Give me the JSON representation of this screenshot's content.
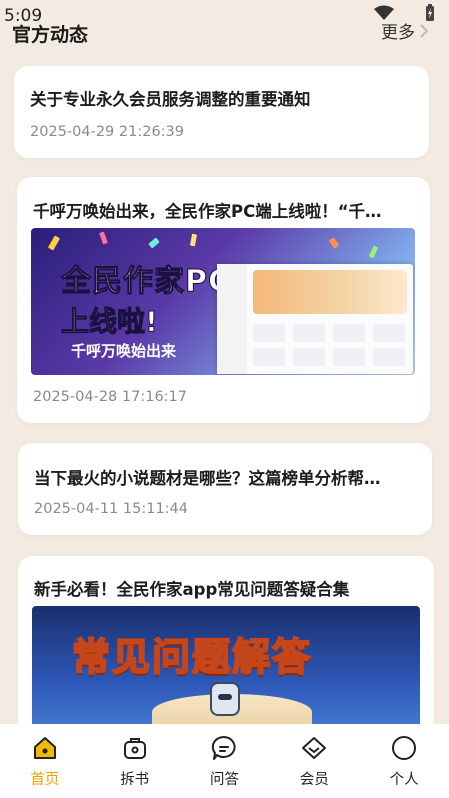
{
  "status_bar": {
    "time": "5:09"
  },
  "header": {
    "title": "官方动态",
    "more_label": "更多"
  },
  "posts": [
    {
      "title": "关于专业永久会员服务调整的重要通知",
      "date": "2025-04-29 21:26:39"
    },
    {
      "title": "千呼万唤始出来，全民作家PC端上线啦！“千…",
      "date": "2025-04-28 17:16:17",
      "banner": {
        "line1": "全民作家PC端",
        "line2": "上线啦!",
        "subtitle": "千呼万唤始出来"
      }
    },
    {
      "title": "当下最火的小说题材是哪些？这篇榜单分析帮…",
      "date": "2025-04-11 15:11:44"
    },
    {
      "title": "新手必看！全民作家app常见问题答疑合集",
      "banner": {
        "text": "常见问题解答"
      }
    }
  ],
  "bottom_nav": [
    {
      "label": "首页",
      "icon": "home-icon",
      "active": true
    },
    {
      "label": "拆书",
      "icon": "book-bag-icon",
      "active": false
    },
    {
      "label": "问答",
      "icon": "chat-bubble-icon",
      "active": false
    },
    {
      "label": "会员",
      "icon": "diamond-icon",
      "active": false
    },
    {
      "label": "个人",
      "icon": "user-circle-icon",
      "active": false
    }
  ],
  "colors": {
    "background": "#f3ebe1",
    "accent": "#e9a400",
    "card": "#ffffff",
    "date_text": "#8a8a8a"
  }
}
